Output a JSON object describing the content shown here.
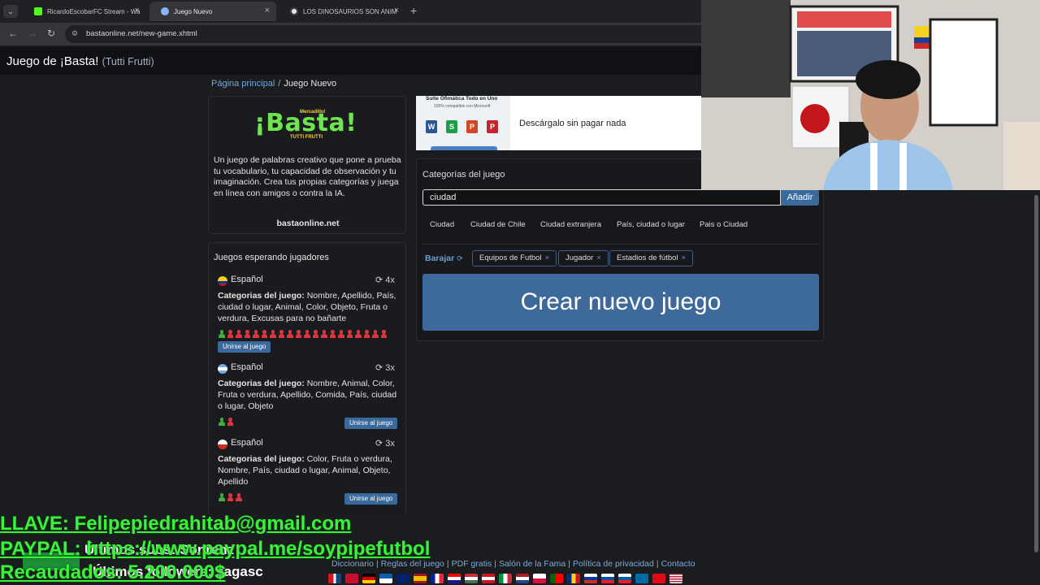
{
  "browser": {
    "tabs": [
      {
        "title": "RicardoEscobarFC Stream - Wa",
        "active": false,
        "icon": "kick-icon"
      },
      {
        "title": "Juego Nuevo",
        "active": true,
        "icon": "basta-icon"
      },
      {
        "title": "LOS DINOSAURIOS SON ANIM",
        "active": false,
        "icon": "globe-icon"
      }
    ],
    "url": "bastaonline.net/new-game.xhtml"
  },
  "site": {
    "brand": "Juego de ¡Basta!",
    "brand_sub": "(Tutti Frutti)",
    "breadcrumb": {
      "home": "Página principal",
      "sep": "/",
      "current": "Juego Nuevo"
    }
  },
  "about": {
    "logo_title": "¡Basta!",
    "logo_top": "Mercadillo!",
    "logo_bottom": "TUTTI FRUTTI",
    "text": "Un juego de palabras creativo que pone a prueba tu vocabulario, tu capacidad de observación y tu imaginación. Crea tus propias categorías y juega en línea con amigos o contra la IA.",
    "site": "bastaonline.net"
  },
  "waiting": {
    "title": "Juegos esperando jugadores",
    "cats_label": "Categorias del juego:",
    "games": [
      {
        "lang": "Español",
        "rounds": "4x",
        "flag": "colombia",
        "categories": "Nombre, Apellido, País, ciudad o lugar, Animal, Color, Objeto, Fruta o verdura, Excusas para no bañarte",
        "players_me": 1,
        "players_other": 19,
        "join": "Unirse al juego"
      },
      {
        "lang": "Español",
        "rounds": "3x",
        "flag": "argentina",
        "categories": "Nombre, Animal, Color, Fruta o verdura, Apellido, Comida, País, ciudad o lugar, Objeto",
        "players_me": 1,
        "players_other": 1,
        "join": "Unirse al juego"
      },
      {
        "lang": "Español",
        "rounds": "3x",
        "flag": "chile",
        "categories": "Color, Fruta o verdura, Nombre, País, ciudad o lugar, Animal, Objeto, Apellido",
        "players_me": 1,
        "players_other": 2,
        "join": "Unirse al juego"
      }
    ]
  },
  "ad": {
    "title": "Suite Ofimática Todo en Uno",
    "subtitle": "100% compatible con Microsoft",
    "text": "Descárgalo sin pagar nada",
    "apps": [
      "W",
      "S",
      "P",
      "P"
    ]
  },
  "categories": {
    "title": "Categorías del juego",
    "input_value": "ciudad",
    "add_label": "Añadir",
    "suggestions": [
      "Ciudad",
      "Ciudad de Chile",
      "Ciudad extranjera",
      "País, ciudad o lugar",
      "Pais o Ciudad"
    ],
    "shuffle_label": "Barajar",
    "selected": [
      "Equipos de Futbol",
      "Jugador",
      "Estadios de fútbol"
    ],
    "create_label": "Crear nuevo juego"
  },
  "footer": {
    "links": [
      "Diccionario",
      "Reglas del juego",
      "PDF gratis",
      "Salón de la Fama",
      "Política de privacidad",
      "Contacto"
    ]
  },
  "overlay": {
    "email_line": "LLAVE: Felipepiedrahitab@gmail.com",
    "paypal_line": "PAYPAL: https://www.paypal.me/soypipefutbol",
    "raised_line": "Recaudados: 5.200.000$",
    "subs_line": "Últimos subs: Sonrenz",
    "followers_line": "Últimos followers: sagasc"
  },
  "colors": {
    "accent_blue": "#3a6a9b",
    "link_blue": "#79a8d8",
    "logo_green": "#6ee54f",
    "overlay_green": "#39f23a"
  }
}
